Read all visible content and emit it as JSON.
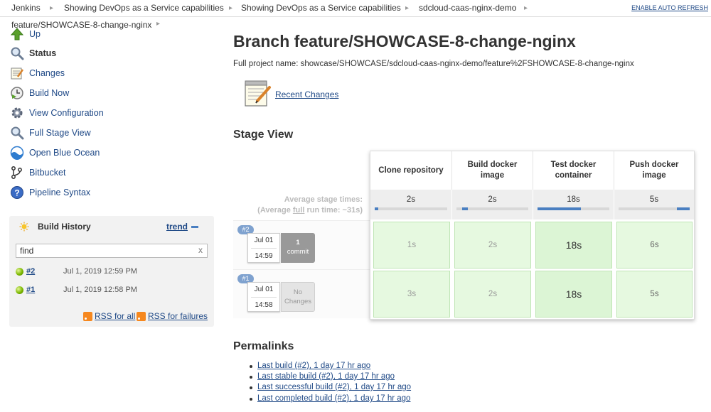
{
  "breadcrumb": {
    "items": [
      "Jenkins",
      "Showing DevOps as a Service capabilities",
      "Showing DevOps as a Service capabilities",
      "sdcloud-caas-nginx-demo",
      "feature/SHOWCASE-8-change-nginx"
    ],
    "auto_refresh": "ENABLE AUTO REFRESH"
  },
  "sidebar": {
    "tasks": [
      {
        "label": "Up",
        "icon": "up-arrow-icon"
      },
      {
        "label": "Status",
        "icon": "magnifier-icon"
      },
      {
        "label": "Changes",
        "icon": "notepad-icon"
      },
      {
        "label": "Build Now",
        "icon": "clock-play-icon"
      },
      {
        "label": "View Configuration",
        "icon": "gear-icon"
      },
      {
        "label": "Full Stage View",
        "icon": "magnifier-icon"
      },
      {
        "label": "Open Blue Ocean",
        "icon": "blue-ocean-icon"
      },
      {
        "label": "Bitbucket",
        "icon": "bitbucket-branch-icon"
      },
      {
        "label": "Pipeline Syntax",
        "icon": "help-icon"
      }
    ]
  },
  "build_history": {
    "title": "Build History",
    "trend": "trend",
    "search_value": "find",
    "clear": "x",
    "builds": [
      {
        "number": "#2",
        "date": "Jul 1, 2019 12:59 PM"
      },
      {
        "number": "#1",
        "date": "Jul 1, 2019 12:58 PM"
      }
    ],
    "rss_all": "RSS for all",
    "rss_failures": "RSS for failures"
  },
  "main": {
    "title": "Branch feature/SHOWCASE-8-change-nginx",
    "full_project_name": "Full project name: showcase/SHOWCASE/sdcloud-caas-nginx-demo/feature%2FSHOWCASE-8-change-nginx",
    "recent_changes": "Recent Changes",
    "stage_view_title": "Stage View",
    "permalinks_title": "Permalinks"
  },
  "stage_view": {
    "avg_label": "Average stage times:",
    "avg_run_prefix": "(Average ",
    "avg_run_full": "full",
    "avg_run_suffix": " run time: ~31s)",
    "stages": [
      {
        "name": "Clone repository",
        "avg": "2s",
        "fraction": 0.05
      },
      {
        "name": "Build docker image",
        "avg": "2s",
        "fraction": 0.08
      },
      {
        "name": "Test docker container",
        "avg": "18s",
        "fraction": 0.6
      },
      {
        "name": "Push docker image",
        "avg": "5s",
        "fraction": 0.18
      }
    ],
    "runs": [
      {
        "badge": "#2",
        "date": "Jul 01",
        "time": "14:59",
        "changes_num": "1",
        "changes_text": "commit",
        "times": [
          "1s",
          "2s",
          "18s",
          "6s"
        ]
      },
      {
        "badge": "#1",
        "date": "Jul 01",
        "time": "14:58",
        "changes_num": "No",
        "changes_text": "Changes",
        "times": [
          "3s",
          "2s",
          "18s",
          "5s"
        ]
      }
    ]
  },
  "permalinks": [
    "Last build (#2), 1 day 17 hr ago",
    "Last stable build (#2), 1 day 17 hr ago",
    "Last successful build (#2), 1 day 17 hr ago",
    "Last completed build (#2), 1 day 17 hr ago"
  ],
  "colors": {
    "link": "#204a87",
    "success_cell": "#e6f9e0",
    "badge": "#7fa2cf"
  }
}
